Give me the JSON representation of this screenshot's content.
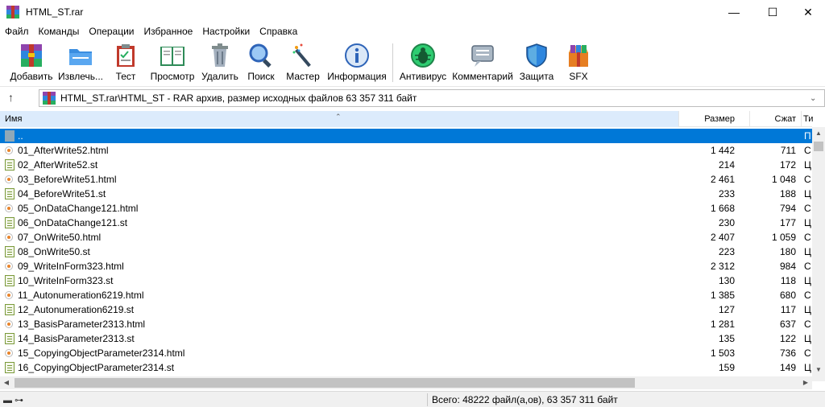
{
  "window": {
    "title": "HTML_ST.rar",
    "controls": {
      "minimize": "—",
      "maximize": "☐",
      "close": "✕"
    }
  },
  "menu": [
    "Файл",
    "Команды",
    "Операции",
    "Избранное",
    "Настройки",
    "Справка"
  ],
  "toolbar": {
    "buttons": [
      {
        "label": "Добавить",
        "icon": "add-archive-icon",
        "color": "#c0392b"
      },
      {
        "label": "Извлечь...",
        "icon": "extract-folder-icon",
        "color": "#2e86de"
      },
      {
        "label": "Тест",
        "icon": "test-clipboard-icon",
        "color": "#c0392b"
      },
      {
        "label": "Просмотр",
        "icon": "view-book-icon",
        "color": "#27ae60"
      },
      {
        "label": "Удалить",
        "icon": "trash-icon",
        "color": "#7f8c8d"
      },
      {
        "label": "Поиск",
        "icon": "search-magnifier-icon",
        "color": "#2e86de"
      },
      {
        "label": "Мастер",
        "icon": "wizard-wand-icon",
        "color": "#34495e"
      },
      {
        "label": "Информация",
        "icon": "info-icon",
        "color": "#2e64b8"
      },
      {
        "label": "Антивирус",
        "icon": "antivirus-bug-icon",
        "color": "#27ae60"
      },
      {
        "label": "Комментарий",
        "icon": "comment-icon",
        "color": "#5d6d7e"
      },
      {
        "label": "Защита",
        "icon": "shield-icon",
        "color": "#2e86de"
      },
      {
        "label": "SFX",
        "icon": "sfx-box-icon",
        "color": "#e67e22"
      }
    ]
  },
  "address": {
    "up_glyph": "↑",
    "path": "HTML_ST.rar\\HTML_ST - RAR архив, размер исходных файлов 63 357 311 байт",
    "drop_glyph": "⌄"
  },
  "columns": {
    "name": "Имя",
    "size": "Размер",
    "packed": "Сжат",
    "type": "Ти"
  },
  "files": [
    {
      "name": "..",
      "size": "",
      "packed": "",
      "type": "П",
      "kind": "up"
    },
    {
      "name": "01_AfterWrite52.html",
      "size": "1 442",
      "packed": "711",
      "type": "С",
      "kind": "html"
    },
    {
      "name": "02_AfterWrite52.st",
      "size": "214",
      "packed": "172",
      "type": "Ц",
      "kind": "st"
    },
    {
      "name": "03_BeforeWrite51.html",
      "size": "2 461",
      "packed": "1 048",
      "type": "С",
      "kind": "html"
    },
    {
      "name": "04_BeforeWrite51.st",
      "size": "233",
      "packed": "188",
      "type": "Ц",
      "kind": "st"
    },
    {
      "name": "05_OnDataChange121.html",
      "size": "1 668",
      "packed": "794",
      "type": "С",
      "kind": "html"
    },
    {
      "name": "06_OnDataChange121.st",
      "size": "230",
      "packed": "177",
      "type": "Ц",
      "kind": "st"
    },
    {
      "name": "07_OnWrite50.html",
      "size": "2 407",
      "packed": "1 059",
      "type": "С",
      "kind": "html"
    },
    {
      "name": "08_OnWrite50.st",
      "size": "223",
      "packed": "180",
      "type": "Ц",
      "kind": "st"
    },
    {
      "name": "09_WriteInForm323.html",
      "size": "2 312",
      "packed": "984",
      "type": "С",
      "kind": "html"
    },
    {
      "name": "10_WriteInForm323.st",
      "size": "130",
      "packed": "118",
      "type": "Ц",
      "kind": "st"
    },
    {
      "name": "11_Autonumeration6219.html",
      "size": "1 385",
      "packed": "680",
      "type": "С",
      "kind": "html"
    },
    {
      "name": "12_Autonumeration6219.st",
      "size": "127",
      "packed": "117",
      "type": "Ц",
      "kind": "st"
    },
    {
      "name": "13_BasisParameter2313.html",
      "size": "1 281",
      "packed": "637",
      "type": "С",
      "kind": "html"
    },
    {
      "name": "14_BasisParameter2313.st",
      "size": "135",
      "packed": "122",
      "type": "Ц",
      "kind": "st"
    },
    {
      "name": "15_CopyingObjectParameter2314.html",
      "size": "1 503",
      "packed": "736",
      "type": "С",
      "kind": "html"
    },
    {
      "name": "16_CopyingObjectParameter2314.st",
      "size": "159",
      "packed": "149",
      "type": "Ц",
      "kind": "st"
    }
  ],
  "status": {
    "text": "Всего: 48222 файл(а,ов), 63 357 311 байт",
    "icons": "▬ ⊶"
  },
  "colors": {
    "selection": "#0078d7",
    "header_highlight": "#dcebfc"
  }
}
